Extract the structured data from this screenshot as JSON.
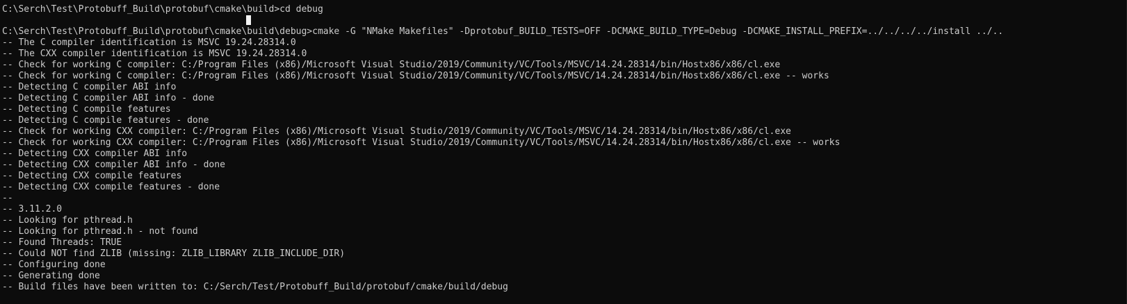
{
  "terminal": {
    "lines": [
      "C:\\Serch\\Test\\Protobuff_Build\\protobuf\\cmake\\build>cd debug",
      "",
      "C:\\Serch\\Test\\Protobuff_Build\\protobuf\\cmake\\build\\debug>cmake -G \"NMake Makefiles\" -Dprotobuf_BUILD_TESTS=OFF -DCMAKE_BUILD_TYPE=Debug -DCMAKE_INSTALL_PREFIX=../../../../install ../..",
      "-- The C compiler identification is MSVC 19.24.28314.0",
      "-- The CXX compiler identification is MSVC 19.24.28314.0",
      "-- Check for working C compiler: C:/Program Files (x86)/Microsoft Visual Studio/2019/Community/VC/Tools/MSVC/14.24.28314/bin/Hostx86/x86/cl.exe",
      "-- Check for working C compiler: C:/Program Files (x86)/Microsoft Visual Studio/2019/Community/VC/Tools/MSVC/14.24.28314/bin/Hostx86/x86/cl.exe -- works",
      "-- Detecting C compiler ABI info",
      "-- Detecting C compiler ABI info - done",
      "-- Detecting C compile features",
      "-- Detecting C compile features - done",
      "-- Check for working CXX compiler: C:/Program Files (x86)/Microsoft Visual Studio/2019/Community/VC/Tools/MSVC/14.24.28314/bin/Hostx86/x86/cl.exe",
      "-- Check for working CXX compiler: C:/Program Files (x86)/Microsoft Visual Studio/2019/Community/VC/Tools/MSVC/14.24.28314/bin/Hostx86/x86/cl.exe -- works",
      "-- Detecting CXX compiler ABI info",
      "-- Detecting CXX compiler ABI info - done",
      "-- Detecting CXX compile features",
      "-- Detecting CXX compile features - done",
      "--",
      "-- 3.11.2.0",
      "-- Looking for pthread.h",
      "-- Looking for pthread.h - not found",
      "-- Found Threads: TRUE",
      "-- Could NOT find ZLIB (missing: ZLIB_LIBRARY ZLIB_INCLUDE_DIR)",
      "-- Configuring done",
      "-- Generating done",
      "-- Build files have been written to: C:/Serch/Test/Protobuff_Build/protobuf/cmake/build/debug"
    ],
    "colors": {
      "background": "#0c0c0c",
      "foreground": "#cccccc",
      "cursor": "#f2f2f2"
    }
  }
}
